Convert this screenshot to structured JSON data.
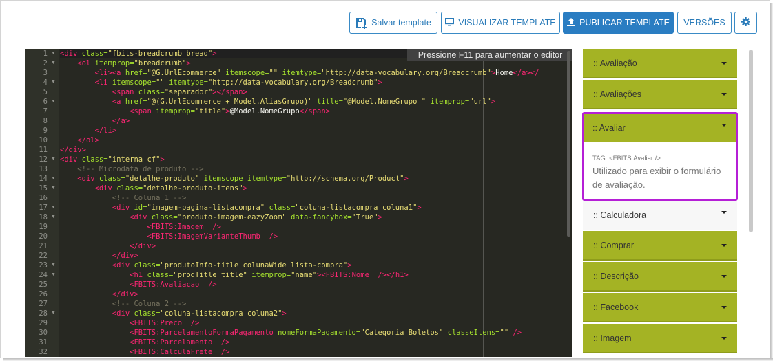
{
  "toolbar": {
    "save_label": "Salvar template",
    "view_label": "VISUALIZAR TEMPLATE",
    "publish_label": "PUBLICAR TEMPLATE",
    "versions_label": "VERSÕES",
    "accent_color": "#2a7dc2"
  },
  "editor": {
    "tooltip": "Pressione F11 para aumentar o editor",
    "theme": "monokai",
    "line_numbers": [
      "1",
      "2",
      "3",
      "4",
      "5",
      "6",
      "7",
      "8",
      "9",
      "10",
      "11",
      "12",
      "13",
      "14",
      "15",
      "16",
      "17",
      "18",
      "19",
      "20",
      "21",
      "22",
      "23",
      "24",
      "25",
      "26",
      "27",
      "28",
      "29",
      "30",
      "31",
      "32"
    ],
    "lines": [
      [
        [
          "tg",
          "<div "
        ],
        [
          "at",
          "class="
        ],
        [
          "st",
          "\"fbits-breadcrumb bread\""
        ],
        [
          "tg",
          ">"
        ]
      ],
      [
        [
          "tx",
          "    "
        ],
        [
          "tg",
          "<ol "
        ],
        [
          "at",
          "itemprop="
        ],
        [
          "st",
          "\"breadcrumb\""
        ],
        [
          "tg",
          ">"
        ]
      ],
      [
        [
          "tx",
          "        "
        ],
        [
          "tg",
          "<li><a "
        ],
        [
          "at",
          "href="
        ],
        [
          "st",
          "\"@G.UrlEcommerce\" "
        ],
        [
          "at",
          "itemscope="
        ],
        [
          "st",
          "\"\" "
        ],
        [
          "at",
          "itemtype="
        ],
        [
          "st",
          "\"http://data-vocabulary.org/Breadcrumb\""
        ],
        [
          "tg",
          ">"
        ],
        [
          "tx",
          "Home"
        ],
        [
          "tg",
          "</a></"
        ]
      ],
      [
        [
          "tx",
          "        "
        ],
        [
          "tg",
          "<li "
        ],
        [
          "at",
          "itemscope="
        ],
        [
          "st",
          "\"\" "
        ],
        [
          "at",
          "itemtype="
        ],
        [
          "st",
          "\"http://data-vocabulary.org/Breadcrumb\""
        ],
        [
          "tg",
          ">"
        ]
      ],
      [
        [
          "tx",
          "            "
        ],
        [
          "tg",
          "<span "
        ],
        [
          "at",
          "class="
        ],
        [
          "st",
          "\"separador\""
        ],
        [
          "tg",
          "></span>"
        ]
      ],
      [
        [
          "tx",
          "            "
        ],
        [
          "tg",
          "<a "
        ],
        [
          "at",
          "href="
        ],
        [
          "st",
          "\"@(G.UrlEcommerce + Model.AliasGrupo)\" "
        ],
        [
          "at",
          "title="
        ],
        [
          "st",
          "\"@Model.NomeGrupo \" "
        ],
        [
          "at",
          "itemprop="
        ],
        [
          "st",
          "\"url\""
        ],
        [
          "tg",
          ">"
        ]
      ],
      [
        [
          "tx",
          "                "
        ],
        [
          "tg",
          "<span "
        ],
        [
          "at",
          "itemprop="
        ],
        [
          "st",
          "\"title\""
        ],
        [
          "tg",
          ">"
        ],
        [
          "tx",
          "@Model.NomeGrupo"
        ],
        [
          "tg",
          "</span>"
        ]
      ],
      [
        [
          "tx",
          "            "
        ],
        [
          "tg",
          "</a>"
        ]
      ],
      [
        [
          "tx",
          "        "
        ],
        [
          "tg",
          "</li>"
        ]
      ],
      [
        [
          "tx",
          "    "
        ],
        [
          "tg",
          "</ol>"
        ]
      ],
      [
        [
          "tg",
          "</div>"
        ]
      ],
      [
        [
          "tg",
          "<div "
        ],
        [
          "at",
          "class="
        ],
        [
          "st",
          "\"interna cf\""
        ],
        [
          "tg",
          ">"
        ]
      ],
      [
        [
          "tx",
          "    "
        ],
        [
          "cm",
          "<!-- Microdata de produto -->"
        ]
      ],
      [
        [
          "tx",
          "    "
        ],
        [
          "tg",
          "<div "
        ],
        [
          "at",
          "class="
        ],
        [
          "st",
          "\"detalhe-produto\" "
        ],
        [
          "at",
          "itemscope itemtype="
        ],
        [
          "st",
          "\"http://schema.org/Product\""
        ],
        [
          "tg",
          ">"
        ]
      ],
      [
        [
          "tx",
          "        "
        ],
        [
          "tg",
          "<div "
        ],
        [
          "at",
          "class="
        ],
        [
          "st",
          "\"detalhe-produto-itens\""
        ],
        [
          "tg",
          ">"
        ]
      ],
      [
        [
          "tx",
          "            "
        ],
        [
          "cm",
          "<!-- Coluna 1 -->"
        ]
      ],
      [
        [
          "tx",
          "            "
        ],
        [
          "tg",
          "<div "
        ],
        [
          "at",
          "id="
        ],
        [
          "st",
          "\"imagem-pagina-listacompra\" "
        ],
        [
          "at",
          "class="
        ],
        [
          "st",
          "\"coluna-listacompra coluna1\""
        ],
        [
          "tg",
          ">"
        ]
      ],
      [
        [
          "tx",
          "                "
        ],
        [
          "tg",
          "<div "
        ],
        [
          "at",
          "class="
        ],
        [
          "st",
          "\"produto-imagem-eazyZoom\" "
        ],
        [
          "at",
          "data-fancybox="
        ],
        [
          "st",
          "\"True\""
        ],
        [
          "tg",
          ">"
        ]
      ],
      [
        [
          "tx",
          "                    "
        ],
        [
          "tg",
          "<FBITS:Imagem  "
        ],
        [
          "tg",
          "/>"
        ]
      ],
      [
        [
          "tx",
          "                    "
        ],
        [
          "tg",
          "<FBITS:ImagemVarianteThumb  "
        ],
        [
          "tg",
          "/>"
        ]
      ],
      [
        [
          "tx",
          "                "
        ],
        [
          "tg",
          "</div>"
        ]
      ],
      [
        [
          "tx",
          "            "
        ],
        [
          "tg",
          "</div>"
        ]
      ],
      [
        [
          "tx",
          "            "
        ],
        [
          "tg",
          "<div "
        ],
        [
          "at",
          "class="
        ],
        [
          "st",
          "\"produtoInfo-title colunaWide lista-compra\""
        ],
        [
          "tg",
          ">"
        ]
      ],
      [
        [
          "tx",
          "                "
        ],
        [
          "tg",
          "<h1 "
        ],
        [
          "at",
          "class="
        ],
        [
          "st",
          "\"prodTitle title\" "
        ],
        [
          "at",
          "itemprop="
        ],
        [
          "st",
          "\"name\""
        ],
        [
          "tg",
          "><FBITS:Nome  /></h1>"
        ]
      ],
      [
        [
          "tx",
          "                "
        ],
        [
          "tg",
          "<FBITS:Avaliacao  "
        ],
        [
          "tg",
          "/>"
        ]
      ],
      [
        [
          "tx",
          "            "
        ],
        [
          "tg",
          "</div>"
        ]
      ],
      [
        [
          "tx",
          "            "
        ],
        [
          "cm",
          "<!-- Coluna 2 -->"
        ]
      ],
      [
        [
          "tx",
          "            "
        ],
        [
          "tg",
          "<div "
        ],
        [
          "at",
          "class="
        ],
        [
          "st",
          "\"coluna-listacompra coluna2\""
        ],
        [
          "tg",
          ">"
        ]
      ],
      [
        [
          "tx",
          "                "
        ],
        [
          "tg",
          "<FBITS:Preco  "
        ],
        [
          "tg",
          "/>"
        ]
      ],
      [
        [
          "tx",
          "                "
        ],
        [
          "tg",
          "<FBITS:ParcelamentoFormaPagamento "
        ],
        [
          "at",
          "nomeFormaPagamento="
        ],
        [
          "st",
          "\"Categoria Boletos\" "
        ],
        [
          "at",
          "classeItens="
        ],
        [
          "st",
          "\"\" "
        ],
        [
          "tg",
          "/>"
        ]
      ],
      [
        [
          "tx",
          "                "
        ],
        [
          "tg",
          "<FBITS:Parcelamento  "
        ],
        [
          "tg",
          "/>"
        ]
      ],
      [
        [
          "tx",
          "                "
        ],
        [
          "tg",
          "<FBITS:CalculaFrete  "
        ],
        [
          "tg",
          "/>"
        ]
      ]
    ]
  },
  "sidebar": {
    "panels_top": [
      ":: Avaliação",
      ":: Avaliações"
    ],
    "open_panel": {
      "title": ":: Avaliar",
      "tag": "TAG: <FBITS:Avaliar />",
      "description": "Utilizado para exibir o formulário de avaliação.",
      "highlight_color": "#b51fd6"
    },
    "panel_light": ":: Calculadora",
    "panels_bottom": [
      ":: Comprar",
      ":: Descrição",
      ":: Facebook",
      ":: Imagem"
    ],
    "panel_color": "#a4b324"
  }
}
